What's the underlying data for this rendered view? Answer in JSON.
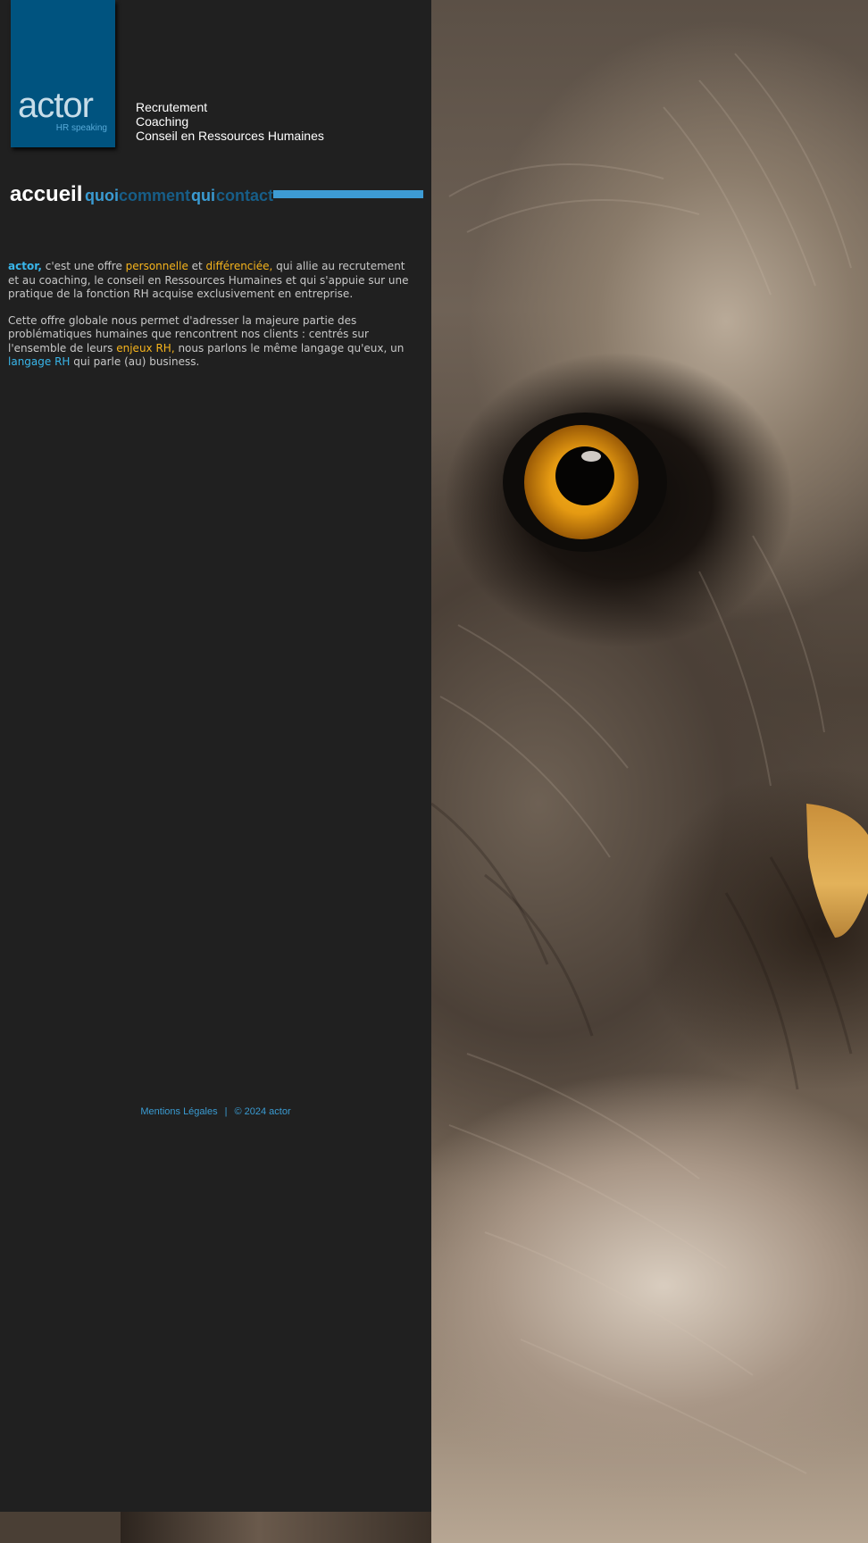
{
  "logo": {
    "word": "actor",
    "sub": "HR speaking"
  },
  "tagline": [
    "Recrutement",
    "Coaching",
    "Conseil en Ressources Humaines"
  ],
  "nav": {
    "accueil": "accueil",
    "quoi": "quoi",
    "comment": "comment",
    "qui": "qui",
    "contact": "contact"
  },
  "content": {
    "p1": {
      "brand": "actor,",
      "t1": " c'est une offre ",
      "h1": "personnelle",
      "t2": " et ",
      "h2": "différenciée,",
      "t3": " qui allie au recrutement et au coaching, le conseil en Ressources Humaines et qui s'appuie sur une pratique de la fonction RH acquise exclusivement en entreprise."
    },
    "p2": {
      "t1": "Cette offre globale nous permet d'adresser la majeure partie des problématiques humaines que rencontrent nos clients : centrés sur l'ensemble de leurs ",
      "h1": "enjeux RH,",
      "t2": " nous parlons le même langage qu'eux, un ",
      "h2": "langage RH",
      "t3": " qui parle (au) business."
    }
  },
  "footer": {
    "legal": "Mentions Légales",
    "separator": "|",
    "copyright": "© 2024 actor"
  },
  "colors": {
    "panel_bg": "#202020",
    "logo_bg": "#00537f",
    "accent_blue": "#3a9bd2",
    "dark_blue": "#175e88",
    "highlight_blue": "#39b6ea",
    "highlight_yellow": "#f6b41c"
  }
}
